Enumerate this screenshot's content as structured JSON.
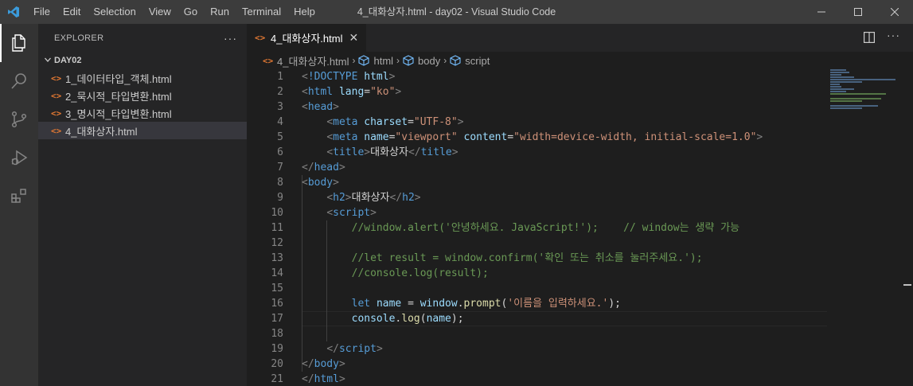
{
  "titlebar": {
    "menu": [
      "File",
      "Edit",
      "Selection",
      "View",
      "Go",
      "Run",
      "Terminal",
      "Help"
    ],
    "title": "4_대화상자.html - day02 - Visual Studio Code",
    "controls": {
      "minimize": "─",
      "maximize": "☐",
      "close": "✕"
    }
  },
  "sidebar": {
    "title": "EXPLORER",
    "more": "···",
    "folder": "DAY02",
    "files": [
      {
        "icon": "<>",
        "name": "1_데이터타입_객체.html"
      },
      {
        "icon": "<>",
        "name": "2_묵시적_타입변환.html"
      },
      {
        "icon": "<>",
        "name": "3_명시적_타입변환.html"
      },
      {
        "icon": "<>",
        "name": "4_대화상자.html"
      }
    ]
  },
  "editor": {
    "tab": {
      "icon": "<>",
      "label": "4_대화상자.html",
      "close": "✕"
    },
    "more": "···",
    "breadcrumb": [
      "4_대화상자.html",
      "html",
      "body",
      "script"
    ],
    "line_numbers": [
      "1",
      "2",
      "3",
      "4",
      "5",
      "6",
      "7",
      "8",
      "9",
      "10",
      "11",
      "12",
      "13",
      "14",
      "15",
      "16",
      "17",
      "18",
      "19",
      "20",
      "21"
    ],
    "code_lines": [
      [
        [
          "t-punc",
          "<"
        ],
        [
          "t-tag",
          "!DOCTYPE"
        ],
        [
          "t-text",
          " "
        ],
        [
          "t-attr",
          "html"
        ],
        [
          "t-punc",
          ">"
        ]
      ],
      [
        [
          "t-punc",
          "<"
        ],
        [
          "t-tag",
          "html"
        ],
        [
          "t-text",
          " "
        ],
        [
          "t-attr",
          "lang"
        ],
        [
          "t-text",
          "="
        ],
        [
          "t-str",
          "\"ko\""
        ],
        [
          "t-punc",
          ">"
        ]
      ],
      [
        [
          "t-punc",
          "<"
        ],
        [
          "t-tag",
          "head"
        ],
        [
          "t-punc",
          ">"
        ]
      ],
      [
        [
          "t-text",
          "    "
        ],
        [
          "t-punc",
          "<"
        ],
        [
          "t-tag",
          "meta"
        ],
        [
          "t-text",
          " "
        ],
        [
          "t-attr",
          "charset"
        ],
        [
          "t-text",
          "="
        ],
        [
          "t-str",
          "\"UTF-8\""
        ],
        [
          "t-punc",
          ">"
        ]
      ],
      [
        [
          "t-text",
          "    "
        ],
        [
          "t-punc",
          "<"
        ],
        [
          "t-tag",
          "meta"
        ],
        [
          "t-text",
          " "
        ],
        [
          "t-attr",
          "name"
        ],
        [
          "t-text",
          "="
        ],
        [
          "t-str",
          "\"viewport\""
        ],
        [
          "t-text",
          " "
        ],
        [
          "t-attr",
          "content"
        ],
        [
          "t-text",
          "="
        ],
        [
          "t-str",
          "\"width=device-width, initial-scale=1.0\""
        ],
        [
          "t-punc",
          ">"
        ]
      ],
      [
        [
          "t-text",
          "    "
        ],
        [
          "t-punc",
          "<"
        ],
        [
          "t-tag",
          "title"
        ],
        [
          "t-punc",
          ">"
        ],
        [
          "t-text",
          "대화상자"
        ],
        [
          "t-punc",
          "</"
        ],
        [
          "t-tag",
          "title"
        ],
        [
          "t-punc",
          ">"
        ]
      ],
      [
        [
          "t-punc",
          "</"
        ],
        [
          "t-tag",
          "head"
        ],
        [
          "t-punc",
          ">"
        ]
      ],
      [
        [
          "t-punc",
          "<"
        ],
        [
          "t-tag",
          "body"
        ],
        [
          "t-punc",
          ">"
        ]
      ],
      [
        [
          "t-text",
          "    "
        ],
        [
          "t-punc",
          "<"
        ],
        [
          "t-tag",
          "h2"
        ],
        [
          "t-punc",
          ">"
        ],
        [
          "t-text",
          "대화상자"
        ],
        [
          "t-punc",
          "</"
        ],
        [
          "t-tag",
          "h2"
        ],
        [
          "t-punc",
          ">"
        ]
      ],
      [
        [
          "t-text",
          "    "
        ],
        [
          "t-punc",
          "<"
        ],
        [
          "t-tag",
          "script"
        ],
        [
          "t-punc",
          ">"
        ]
      ],
      [
        [
          "t-text",
          "        "
        ],
        [
          "t-com",
          "//window.alert('안녕하세요. JavaScript!');    // window는 생략 가능"
        ]
      ],
      [
        [
          "t-text",
          ""
        ]
      ],
      [
        [
          "t-text",
          "        "
        ],
        [
          "t-com",
          "//let result = window.confirm('확인 또는 취소를 눌러주세요.');"
        ]
      ],
      [
        [
          "t-text",
          "        "
        ],
        [
          "t-com",
          "//console.log(result);"
        ]
      ],
      [
        [
          "t-text",
          ""
        ]
      ],
      [
        [
          "t-text",
          "        "
        ],
        [
          "t-kw",
          "let"
        ],
        [
          "t-text",
          " "
        ],
        [
          "t-var",
          "name"
        ],
        [
          "t-text",
          " = "
        ],
        [
          "t-var",
          "window"
        ],
        [
          "t-text",
          "."
        ],
        [
          "t-fn",
          "prompt"
        ],
        [
          "t-text",
          "("
        ],
        [
          "t-str",
          "'이름을 입력하세요.'"
        ],
        [
          "t-text",
          ");"
        ]
      ],
      [
        [
          "t-text",
          "        "
        ],
        [
          "t-var",
          "console"
        ],
        [
          "t-text",
          "."
        ],
        [
          "t-fn",
          "log"
        ],
        [
          "t-text",
          "("
        ],
        [
          "t-var",
          "name"
        ],
        [
          "t-text",
          ");"
        ]
      ],
      [
        [
          "t-text",
          ""
        ]
      ],
      [
        [
          "t-text",
          "    "
        ],
        [
          "t-punc",
          "</"
        ],
        [
          "t-tag",
          "script"
        ],
        [
          "t-punc",
          ">"
        ]
      ],
      [
        [
          "t-punc",
          "</"
        ],
        [
          "t-tag",
          "body"
        ],
        [
          "t-punc",
          ">"
        ]
      ],
      [
        [
          "t-punc",
          "</"
        ],
        [
          "t-tag",
          "html"
        ],
        [
          "t-punc",
          ">"
        ]
      ]
    ]
  },
  "colors": {
    "titlebar": "#3c3c3c",
    "activitybar": "#333333",
    "sidebar": "#252526",
    "editor": "#1e1e1e",
    "html_file_icon": "#e37933",
    "vscode_logo": "#3b9bdb"
  },
  "icons": {
    "activity": [
      "files-icon",
      "search-icon",
      "source-control-icon",
      "run-debug-icon",
      "extensions-icon"
    ]
  }
}
